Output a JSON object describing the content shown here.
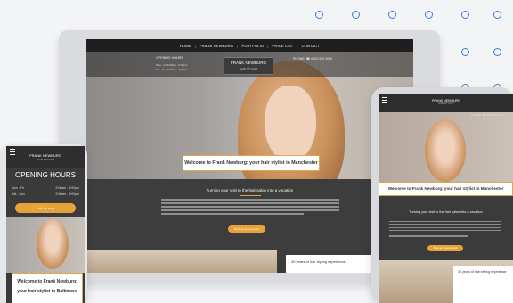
{
  "desktop": {
    "nav": [
      "HOME",
      "FRANK NEWBURG",
      "PORTFOLIO",
      "PRICE LIST",
      "CONTACT"
    ],
    "opening_hours_label": "OPENING HOURS",
    "hours": [
      "Mon - Fri   9:00am - 5:00pm",
      "Sat - Sun   9:00am - 5:00pm"
    ],
    "brand_name": "FRANK NEWBURG",
    "brand_sub": "HAIR STYLIST",
    "phone": "PHONE: ☎ 0000 000 0000",
    "welcome": "Welcome to Frank Newburg: your hair stylist in Manchester",
    "section_title": "Turning your visit to the hair salon into a vacation",
    "cta": "Book an appointment",
    "bottom_title": "30 years of hair styling experience"
  },
  "phone": {
    "brand_name": "FRANK NEWBURG",
    "brand_sub": "HAIR STYLIST",
    "hours_title": "OPENING HOURS",
    "rows": [
      {
        "day": "Mon - Fri",
        "time": "9:00am - 5:00pm"
      },
      {
        "day": "Sat - Sun",
        "time": "9:00am - 5:00pm"
      }
    ],
    "cta": "Call us now",
    "welcome_line1": "Welcome to Frank Newburg:",
    "welcome_line2": "your hair stylist in Baltimore"
  },
  "tablet": {
    "brand_name": "FRANK NEWBURG",
    "brand_sub": "HAIR STYLIST",
    "phone": "PHONE: ☎ 0000 000 000",
    "welcome": "Welcome to Frank Newburg: your hair stylist in Manchester",
    "section_title": "Turning your visit to the hair salon into a vacation",
    "cta": "Book an appointment",
    "bottom_title": "30 years of hair styling experience"
  },
  "colors": {
    "accent": "#e8a23a",
    "dot": "#3d7ad8"
  }
}
